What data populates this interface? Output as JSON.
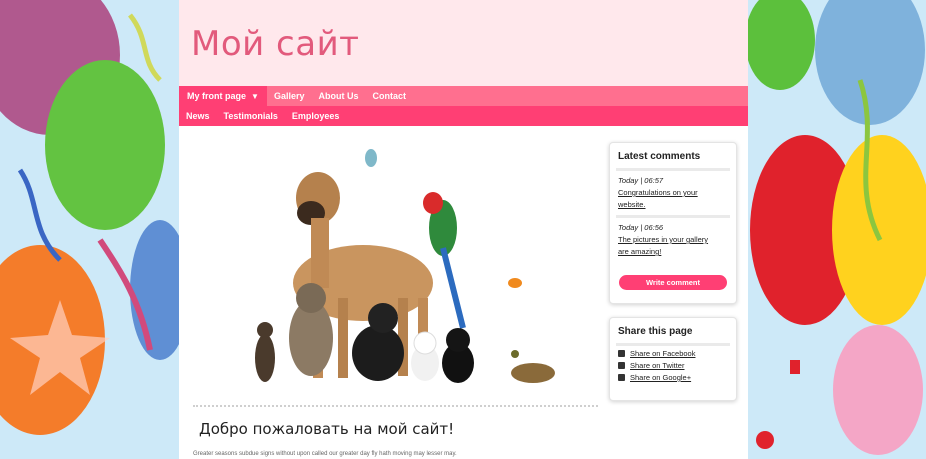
{
  "site": {
    "title": "Мой сайт"
  },
  "nav": {
    "primary": [
      {
        "label": "My front page",
        "active": true
      },
      {
        "label": "Gallery"
      },
      {
        "label": "About Us"
      },
      {
        "label": "Contact"
      }
    ],
    "secondary": [
      {
        "label": "News"
      },
      {
        "label": "Testimonials"
      },
      {
        "label": "Employees"
      }
    ]
  },
  "main": {
    "welcome_heading": "Добро пожаловать на мой сайт!",
    "body_text": "Greater seasons subdue signs without upon called our greater day fly hath moving may lesser may."
  },
  "latest_comments": {
    "title": "Latest comments",
    "items": [
      {
        "time": "Today | 06:57",
        "text_line1": "Congratulations on your",
        "text_line2": "website."
      },
      {
        "time": "Today | 06:56",
        "text_line1": "The pictures in your gallery",
        "text_line2": "are amazing!"
      }
    ],
    "button_label": "Write comment"
  },
  "share": {
    "title": "Share this page",
    "items": [
      {
        "label": "Share on Facebook",
        "icon": "facebook-icon"
      },
      {
        "label": "Share on Twitter",
        "icon": "twitter-icon"
      },
      {
        "label": "Share on Google+",
        "icon": "google-plus-icon"
      }
    ]
  },
  "colors": {
    "header_bg": "#ffe8ec",
    "title": "#e25a7c",
    "nav_primary": "#ff6f8f",
    "nav_secondary": "#ff3f74",
    "accent": "#ff3f74"
  }
}
